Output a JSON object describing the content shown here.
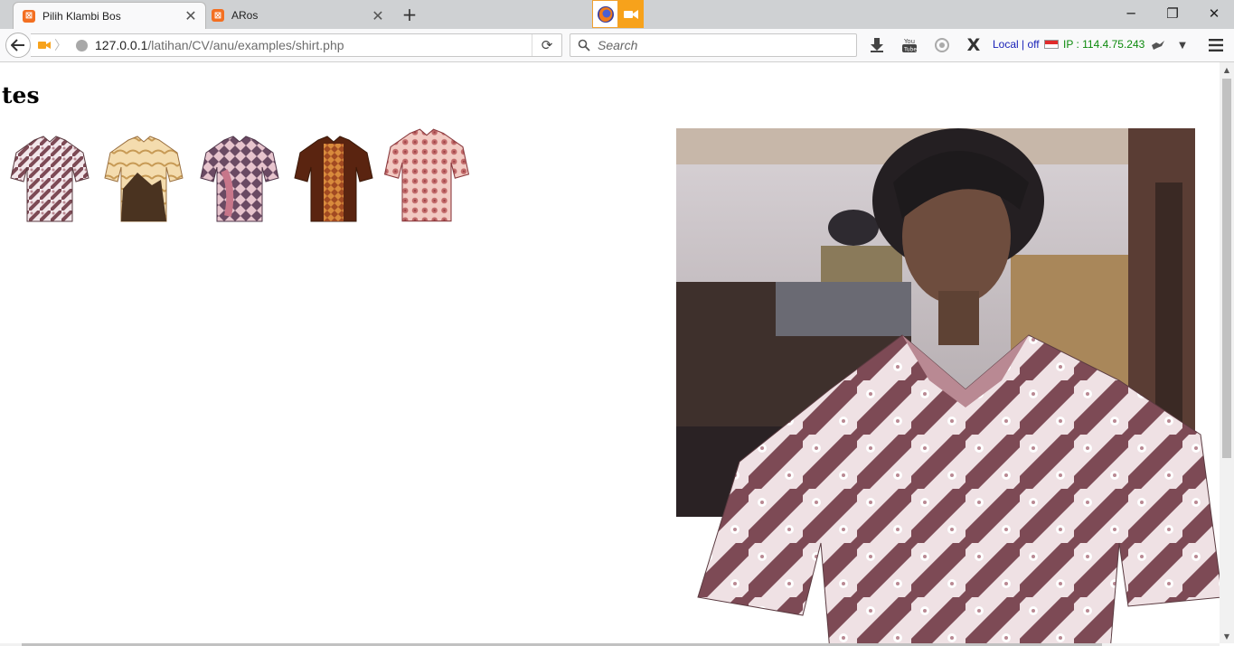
{
  "browser": {
    "tabs": [
      {
        "title": "Pilih Klambi Bos",
        "active": true
      },
      {
        "title": "ARos",
        "active": false
      }
    ],
    "window_controls": [
      "minimize",
      "restore",
      "close"
    ]
  },
  "navbar": {
    "url_host": "127.0.0.1",
    "url_path": "/latihan/CV/anu/examples/shirt.php",
    "search_placeholder": "Search",
    "local_off_label": "Local | off",
    "ip_label": "IP : 114.4.75.243"
  },
  "page": {
    "heading": "tes",
    "shirts": [
      {
        "name": "batik-shirt-1",
        "colors": [
          "#7d4a55",
          "#f2e6ea",
          "#b98993"
        ]
      },
      {
        "name": "batik-shirt-2",
        "colors": [
          "#c79a55",
          "#f4dcae",
          "#4a3320"
        ]
      },
      {
        "name": "batik-shirt-3",
        "colors": [
          "#6a4a63",
          "#e7c4cd",
          "#c7768a"
        ]
      },
      {
        "name": "batik-shirt-4",
        "colors": [
          "#a24a22",
          "#d88a3c",
          "#5a2410"
        ]
      },
      {
        "name": "batik-shirt-5",
        "colors": [
          "#c26a6a",
          "#f2c9c2",
          "#9a3f44"
        ]
      }
    ]
  },
  "colors": {
    "accent_orange": "#f7a21b",
    "local_off": "#1a22b8",
    "ip_green": "#0c8a0c"
  }
}
